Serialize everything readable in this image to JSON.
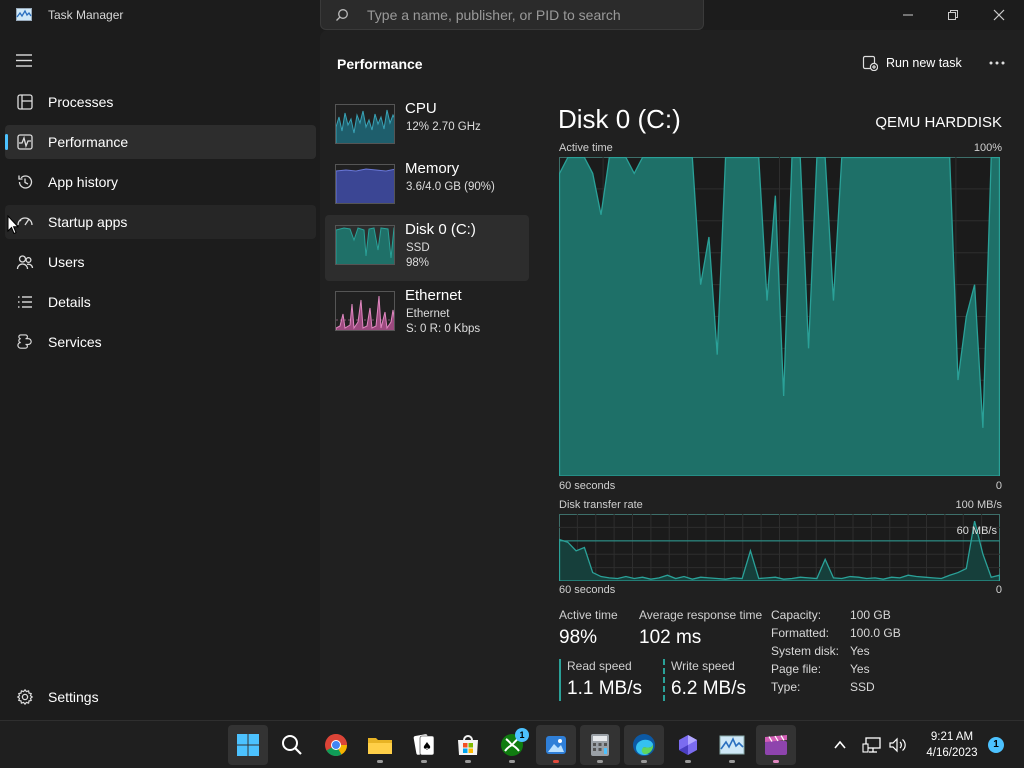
{
  "window": {
    "title": "Task Manager"
  },
  "search": {
    "placeholder": "Type a name, publisher, or PID to search"
  },
  "sidebar": {
    "items": [
      {
        "label": "Processes",
        "icon": "processes-icon"
      },
      {
        "label": "Performance",
        "icon": "performance-icon",
        "active": true
      },
      {
        "label": "App history",
        "icon": "history-icon"
      },
      {
        "label": "Startup apps",
        "icon": "startup-icon"
      },
      {
        "label": "Users",
        "icon": "users-icon"
      },
      {
        "label": "Details",
        "icon": "details-icon"
      },
      {
        "label": "Services",
        "icon": "services-icon"
      }
    ],
    "settings_label": "Settings"
  },
  "header": {
    "title": "Performance",
    "run_task_label": "Run new task"
  },
  "devices": [
    {
      "name": "CPU",
      "line2": "12% 2.70 GHz",
      "line3": "",
      "color": "#39a2b5"
    },
    {
      "name": "Memory",
      "line2": "3.6/4.0 GB (90%)",
      "line3": "",
      "color": "#5566c8"
    },
    {
      "name": "Disk 0 (C:)",
      "line2": "SSD",
      "line3": "98%",
      "color": "#2aa198",
      "active": true
    },
    {
      "name": "Ethernet",
      "line2": "Ethernet",
      "line3": "S: 0 R: 0 Kbps",
      "color": "#e087c0"
    }
  ],
  "detail": {
    "title": "Disk 0 (C:)",
    "model": "QEMU HARDDISK",
    "active_label": "Active time",
    "active_max": "100%",
    "seconds_label": "60 seconds",
    "zero": "0",
    "transfer_label": "Disk transfer rate",
    "transfer_max": "100 MB/s",
    "transfer_mid": "60 MB/s",
    "accent": "#2aa198"
  },
  "stats": {
    "active_time_label": "Active time",
    "active_time": "98%",
    "avg_resp_label": "Average response time",
    "avg_resp": "102 ms",
    "read_label": "Read speed",
    "read": "1.1 MB/s",
    "write_label": "Write speed",
    "write": "6.2 MB/s"
  },
  "props": [
    {
      "k": "Capacity:",
      "v": "100 GB"
    },
    {
      "k": "Formatted:",
      "v": "100.0 GB"
    },
    {
      "k": "System disk:",
      "v": "Yes"
    },
    {
      "k": "Page file:",
      "v": "Yes"
    },
    {
      "k": "Type:",
      "v": "SSD"
    }
  ],
  "chart_data": [
    {
      "type": "area",
      "title": "Active time",
      "y_max_label": "100%",
      "x_label": "60 seconds",
      "ylim": [
        0,
        100
      ],
      "values": [
        95,
        100,
        100,
        100,
        95,
        82,
        100,
        100,
        100,
        95,
        100,
        100,
        100,
        100,
        100,
        100,
        100,
        60,
        75,
        38,
        100,
        100,
        100,
        100,
        100,
        55,
        88,
        25,
        100,
        100,
        40,
        100,
        100,
        55,
        100,
        100,
        100,
        100,
        100,
        100,
        100,
        100,
        100,
        100,
        100,
        100,
        100,
        100,
        30,
        50,
        60,
        15,
        100,
        100
      ]
    },
    {
      "type": "area",
      "title": "Disk transfer rate",
      "y_max_label": "100 MB/s",
      "reference_label": "60 MB/s",
      "x_label": "60 seconds",
      "ylim": [
        0,
        100
      ],
      "values": [
        62,
        58,
        45,
        50,
        12,
        6,
        4,
        3,
        6,
        3,
        5,
        2,
        4,
        8,
        3,
        6,
        2,
        5,
        4,
        3,
        2,
        4,
        3,
        45,
        3,
        4,
        5,
        2,
        3,
        5,
        4,
        3,
        32,
        4,
        3,
        6,
        5,
        3,
        4,
        2,
        5,
        4,
        8,
        6,
        5,
        4,
        3,
        8,
        12,
        18,
        90,
        40,
        5,
        8
      ]
    }
  ],
  "taskbar": {
    "apps": [
      "windows-start",
      "search",
      "chrome",
      "file-explorer",
      "solitaire",
      "store",
      "xbox",
      "photos",
      "calculator",
      "edge",
      "copilot",
      "task-manager",
      "clipchamp"
    ],
    "xbox_badge": "1",
    "time": "9:21 AM",
    "date": "4/16/2023",
    "notification_count": "1"
  }
}
